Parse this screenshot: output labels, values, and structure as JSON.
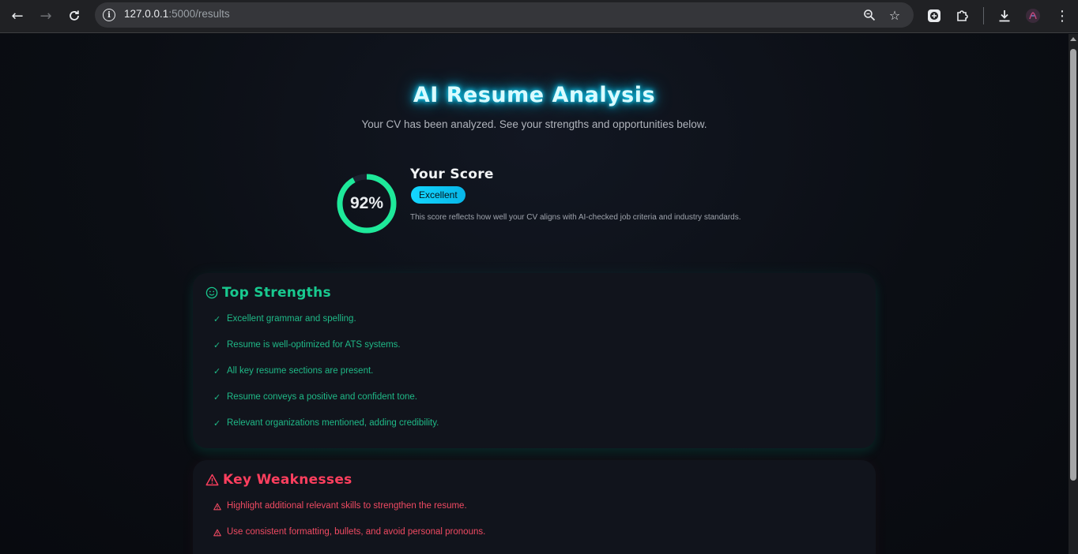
{
  "browser": {
    "url_host": "127.0.0.1",
    "url_path": ":5000/results",
    "icons": [
      "back-icon",
      "forward-icon",
      "reload-icon",
      "site-info-icon",
      "zoom-icon",
      "bookmark-star-icon",
      "extension-icon",
      "puzzle-extensions-icon",
      "download-icon",
      "profile-icon",
      "menu-icon"
    ]
  },
  "header": {
    "title": "AI Resume Analysis",
    "subtitle": "Your CV has been analyzed. See your strengths and opportunities below."
  },
  "score": {
    "value": 92,
    "label": "92%",
    "title": "Your Score",
    "badge": "Excellent",
    "description": "This score reflects how well your CV aligns with AI-checked job criteria and industry standards.",
    "ring_color": "#1ee99a"
  },
  "strengths": {
    "title": "Top Strengths",
    "icon": "smiley-icon",
    "color": "#19c98f",
    "items": [
      "Excellent grammar and spelling.",
      "Resume is well-optimized for ATS systems.",
      "All key resume sections are present.",
      "Resume conveys a positive and confident tone.",
      "Relevant organizations mentioned, adding credibility."
    ]
  },
  "weaknesses": {
    "title": "Key Weaknesses",
    "icon": "warning-icon",
    "color": "#ff3f5e",
    "items": [
      "Highlight additional relevant skills to strengthen the resume.",
      "Use consistent formatting, bullets, and avoid personal pronouns."
    ]
  }
}
